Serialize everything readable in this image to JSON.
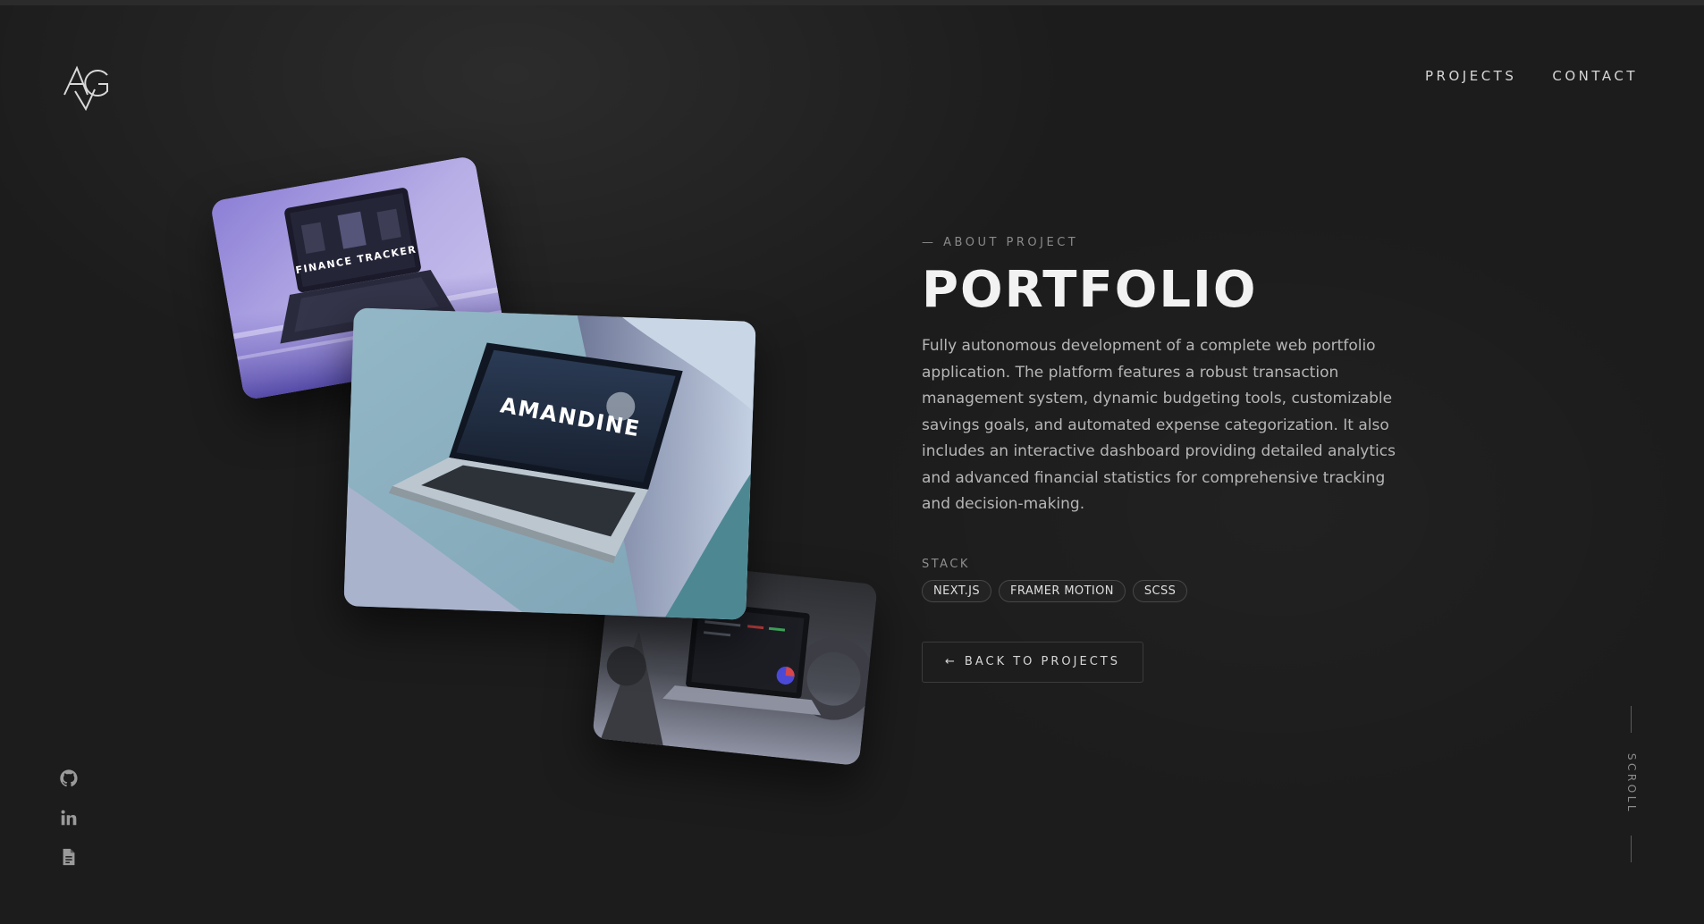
{
  "brand": {
    "logo_text": "AG"
  },
  "nav": {
    "items": [
      {
        "label": "PROJECTS"
      },
      {
        "label": "CONTACT"
      }
    ]
  },
  "gallery": {
    "cards": [
      {
        "label": "FINANCE TRACKER"
      },
      {
        "label": "AMANDINE"
      },
      {
        "label": ""
      }
    ]
  },
  "about": {
    "eyebrow": "— ABOUT PROJECT",
    "title": "PORTFOLIO",
    "description": "Fully autonomous development of a complete web portfolio application. The platform features a robust transaction management system, dynamic budgeting tools, customizable savings goals, and automated expense categorization. It also includes an interactive dashboard providing detailed analytics and advanced financial statistics for comprehensive tracking and decision-making.",
    "stack_label": "STACK",
    "stack": [
      "NEXT.JS",
      "FRAMER MOTION",
      "SCSS"
    ],
    "back_button": {
      "arrow": "←",
      "label": "BACK TO PROJECTS"
    }
  },
  "socials": [
    {
      "icon": "github-icon"
    },
    {
      "icon": "linkedin-icon"
    },
    {
      "icon": "document-icon"
    }
  ],
  "scroll": {
    "label": "SCROLL"
  },
  "colors": {
    "background": "#1c1c1c",
    "text": "#e8e8e8",
    "muted": "#8a8a8a",
    "chip_border": "#474747"
  }
}
